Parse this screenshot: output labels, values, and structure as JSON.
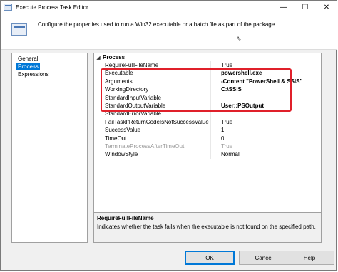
{
  "window": {
    "title": "Execute Process Task Editor",
    "controls": {
      "minimize": "—",
      "maximize": "☐",
      "close": "✕"
    }
  },
  "header": {
    "text": "Configure the properties used to run a Win32 executable or a batch file as part of the package."
  },
  "nav": {
    "items": [
      {
        "label": "General"
      },
      {
        "label": "Process",
        "selected": true
      },
      {
        "label": "Expressions"
      }
    ]
  },
  "grid": {
    "category": "Process",
    "toggle": "◢",
    "rows": [
      {
        "name": "RequireFullFileName",
        "value": "True"
      },
      {
        "name": "Executable",
        "value": "powershell.exe",
        "bold": true
      },
      {
        "name": "Arguments",
        "value": "-Content \"PowerShell & SSIS\"",
        "bold": true
      },
      {
        "name": "WorkingDirectory",
        "value": "C:\\SSIS",
        "bold": true
      },
      {
        "name": "StandardInputVariable",
        "value": ""
      },
      {
        "name": "StandardOutputVariable",
        "value": "User::PSOutput",
        "bold": true
      },
      {
        "name": "StandardErrorVariable",
        "value": ""
      },
      {
        "name": "FailTaskIfReturnCodeIsNotSuccessValue",
        "value": "True"
      },
      {
        "name": "SuccessValue",
        "value": "1"
      },
      {
        "name": "TimeOut",
        "value": "0"
      },
      {
        "name": "TerminateProcessAfterTimeOut",
        "value": "True",
        "disabled": true
      },
      {
        "name": "WindowStyle",
        "value": "Normal"
      }
    ]
  },
  "description": {
    "title": "RequireFullFileName",
    "text": "Indicates whether the task fails when the executable is not found on the specified path."
  },
  "buttons": {
    "ok": "OK",
    "cancel": "Cancel",
    "help": "Help"
  },
  "colors": {
    "highlight_border": "#e0202a",
    "selection": "#0078d7"
  }
}
